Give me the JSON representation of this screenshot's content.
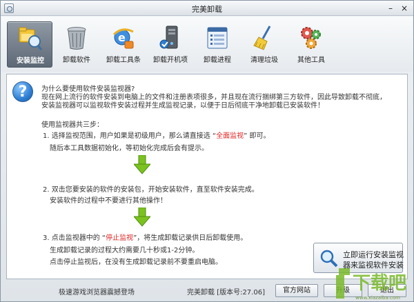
{
  "window": {
    "title": "完美卸载"
  },
  "toolbar": [
    {
      "label": "安装监控",
      "icon": "monitor-folder-icon",
      "active": true
    },
    {
      "label": "卸载软件",
      "icon": "trash-can-icon",
      "active": false
    },
    {
      "label": "卸载工具条",
      "icon": "ie-toolbar-icon",
      "active": false
    },
    {
      "label": "卸载开机项",
      "icon": "pc-tower-icon",
      "active": false
    },
    {
      "label": "卸载进程",
      "icon": "process-window-icon",
      "active": false
    },
    {
      "label": "清理垃圾",
      "icon": "broom-icon",
      "active": false
    },
    {
      "label": "其他工具",
      "icon": "gears-icon",
      "active": false
    }
  ],
  "intro": {
    "q": "为什么要使用软件安装监视器?",
    "line1": "现在网上流行的软件安装到电脑上的文件和注册表项很多，并且现在流行捆绑第三方软件，因此导致卸载不彻底，",
    "line2": "安装监视器可以监视软件安装过程并生成监视记录，以便于日后彻底干净地卸载已安装软件！"
  },
  "steps": {
    "heading": "使用监视器共三步：",
    "s1a": "1. 选择监视范围，用户如果是初级用户，那么请直接选 “",
    "s1_hl": "全面监视",
    "s1b": "” 即可。",
    "s1_sub": "随后本工具数据初始化，等初始化完成后会有提示。",
    "s2": "2. 双击您要安装的软件的安装包，开始安装软件，直至软件安装完成。",
    "s2_sub": "安装软件的过程中不要进行其他操作！",
    "s3a": "3. 点击监视器中的 “",
    "s3_hl": "停止监视",
    "s3b": "”，将生成卸载记录供日后卸载使用。",
    "s3_sub1": "生成卸载记录的过程大约需要几十秒或1-2分钟。",
    "s3_sub2": "点击停止监视后，在没有生成卸载记录前不要重启电脑。"
  },
  "start_button": {
    "line1": "立即运行安装监视",
    "line2": "器来监视软件安装"
  },
  "footer": {
    "link": "极速游戏浏览器震撼登场",
    "version": "完美卸载 [版本号:27.06]",
    "website_btn": "官方网站",
    "upgrade_btn": "升级",
    "exit_btn": "退出"
  },
  "watermark": {
    "text": "下载吧",
    "url": "www.xiazaiba.com"
  },
  "colors": {
    "highlight": "#dd2222",
    "arrow": "#7cc21f",
    "active_tab": "#6b7582"
  }
}
